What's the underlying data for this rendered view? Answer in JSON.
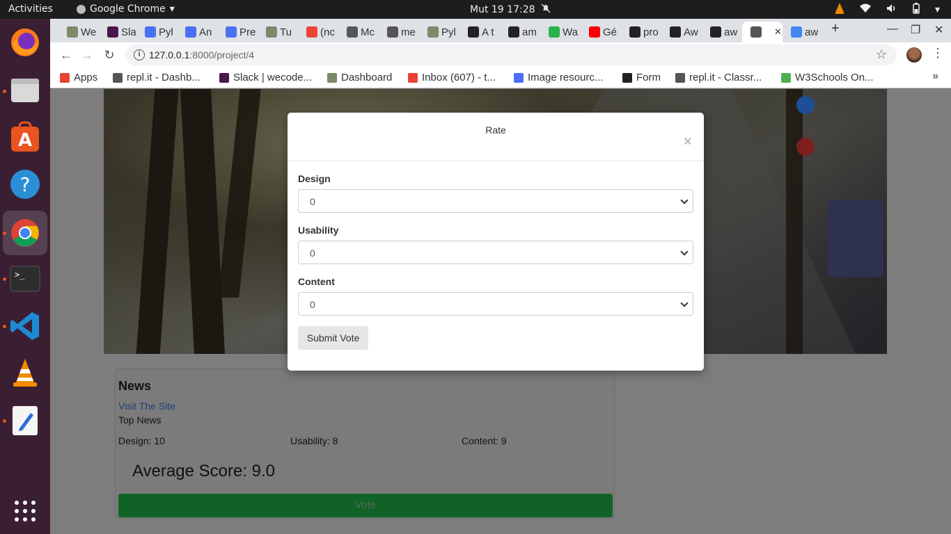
{
  "topbar": {
    "activities": "Activities",
    "app_name": "Google Chrome",
    "clock": "Mut 19  17:28"
  },
  "tabs": [
    {
      "label": "We",
      "favicon_color": "#7a8a6a"
    },
    {
      "label": "Sla",
      "favicon_color": "#4a154b"
    },
    {
      "label": "Pyl",
      "favicon_color": "#4c6ef5"
    },
    {
      "label": "An",
      "favicon_color": "#4c6ef5"
    },
    {
      "label": "Pre",
      "favicon_color": "#4c6ef5"
    },
    {
      "label": "Tu",
      "favicon_color": "#7a8a6a"
    },
    {
      "label": "(nc",
      "favicon_color": "#ea4335"
    },
    {
      "label": "Mc",
      "favicon_color": "#555555"
    },
    {
      "label": "me",
      "favicon_color": "#555555"
    },
    {
      "label": "Pyl",
      "favicon_color": "#7a8a6a"
    },
    {
      "label": "A t",
      "favicon_color": "#222222"
    },
    {
      "label": "am",
      "favicon_color": "#222222"
    },
    {
      "label": "Wa",
      "favicon_color": "#2bb24c"
    },
    {
      "label": "Gé",
      "favicon_color": "#ff0000"
    },
    {
      "label": "pro",
      "favicon_color": "#222222"
    },
    {
      "label": "Aw",
      "favicon_color": "#222222"
    },
    {
      "label": "aw",
      "favicon_color": "#222222"
    },
    {
      "label": "",
      "favicon_color": "#555555",
      "active": true
    },
    {
      "label": "aw",
      "favicon_color": "#4285f4"
    }
  ],
  "toolbar": {
    "url_host": "127.0.0.1",
    "url_path": ":8000/project/4"
  },
  "bookmarks": [
    {
      "label": "Apps",
      "favicon_color": "#ea4335"
    },
    {
      "label": "repl.it - Dashb...",
      "favicon_color": "#555555"
    },
    {
      "label": "Slack | wecode...",
      "favicon_color": "#4a154b"
    },
    {
      "label": "Dashboard",
      "favicon_color": "#7a8a6a"
    },
    {
      "label": "Inbox (607) - t...",
      "favicon_color": "#ea4335"
    },
    {
      "label": "Image resourc...",
      "favicon_color": "#4c6ef5"
    },
    {
      "label": "Form",
      "favicon_color": "#222222"
    },
    {
      "label": "repl.it - Classr...",
      "favicon_color": "#555555"
    },
    {
      "label": "W3Schools On...",
      "favicon_color": "#4caf50"
    }
  ],
  "project_card": {
    "title": "News",
    "link_text": "Visit The Site",
    "description": "Top News",
    "design": "Design: 10",
    "usability": "Usability: 8",
    "content": "Content: 9",
    "average": "Average Score: 9.0",
    "vote_label": "Vote"
  },
  "modal": {
    "title": "Rate",
    "close": "×",
    "fields": [
      {
        "label": "Design",
        "value": "0"
      },
      {
        "label": "Usability",
        "value": "0"
      },
      {
        "label": "Content",
        "value": "0"
      }
    ],
    "submit_label": "Submit Vote"
  }
}
